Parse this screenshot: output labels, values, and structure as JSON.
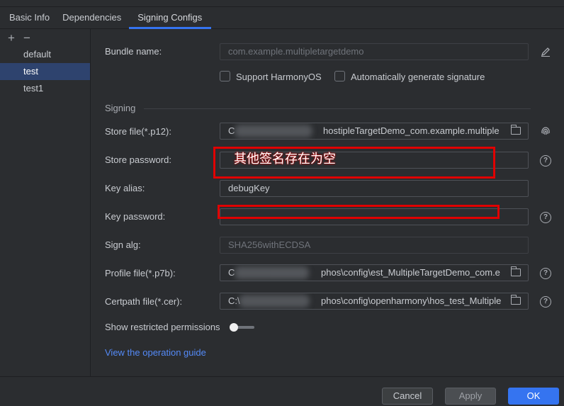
{
  "tabs": [
    {
      "label": "Basic Info"
    },
    {
      "label": "Dependencies"
    },
    {
      "label": "Signing Configs"
    }
  ],
  "sidebar": {
    "add_icon": "plus-icon",
    "remove_icon": "minus-icon",
    "items": [
      {
        "label": "default"
      },
      {
        "label": "test",
        "selected": true
      },
      {
        "label": "test1"
      }
    ]
  },
  "form": {
    "bundle_name_label": "Bundle name:",
    "bundle_name_value": "com.example.multipletargetdemo",
    "support_harmonyos_label": "Support HarmonyOS",
    "auto_sign_label": "Automatically generate signature",
    "signing_section": "Signing",
    "store_file_label": "Store file(*.p12):",
    "store_file_prefix": "C",
    "store_file_value": "hostipleTargetDemo_com.example.multiple",
    "store_password_label": "Store password:",
    "store_password_value": "",
    "key_alias_label": "Key alias:",
    "key_alias_value": "debugKey",
    "key_password_label": "Key password:",
    "key_password_value": "",
    "sign_alg_label": "Sign alg:",
    "sign_alg_value": "SHA256withECDSA",
    "profile_file_label": "Profile file(*.p7b):",
    "profile_file_prefix": "C",
    "profile_file_value": "phos\\config\\est_MultipleTargetDemo_com.e",
    "certpath_file_label": "Certpath file(*.cer):",
    "certpath_file_prefix": "C:\\",
    "certpath_file_value": "phos\\config\\openharmony\\hos_test_Multiple",
    "restricted_label": "Show restricted permissions",
    "restricted_on": false,
    "guide_link": "View the operation guide"
  },
  "annotation": {
    "text": "其他签名存在为空",
    "color": "#e00000"
  },
  "buttons": {
    "cancel": "Cancel",
    "apply": "Apply",
    "ok": "OK"
  },
  "colors": {
    "accent": "#3574f0",
    "link": "#548af7",
    "background": "#2b2d30",
    "selection": "#2e436e"
  }
}
